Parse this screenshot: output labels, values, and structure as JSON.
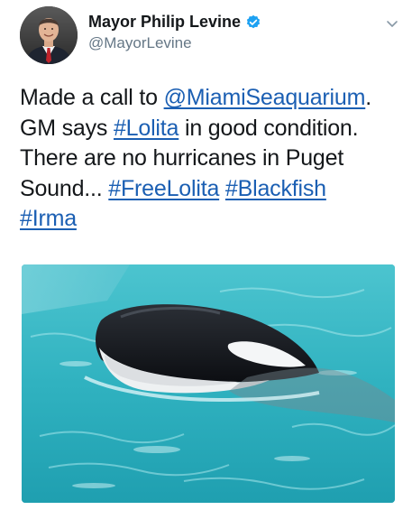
{
  "author": {
    "display_name": "Mayor Philip Levine",
    "handle": "@MayorLevine",
    "verified_icon": "verified-badge-icon",
    "avatar_icon": "profile-photo"
  },
  "menu": {
    "icon": "chevron-down-icon"
  },
  "tweet": {
    "line1_text": "Made a call to ",
    "mention": "@MiamiSeaquarium",
    "line1_end": ".",
    "line2_start": "GM says ",
    "hashtag_lolita": "#Lolita",
    "line2_end": " in good condition.",
    "line3": "There are no hurricanes in Puget",
    "line4_start": "Sound... ",
    "hashtag_freelolita": "#FreeLolita",
    "line4_space": " ",
    "hashtag_blackfish": "#Blackfish",
    "hashtag_irma": "#Irma"
  },
  "media": {
    "image_subject": "orca-in-pool-photo"
  },
  "colors": {
    "link": "#1b5fb3",
    "text": "#14171a",
    "handle": "#657786",
    "verified": "#1da1f2",
    "water": "#35b7c2"
  }
}
